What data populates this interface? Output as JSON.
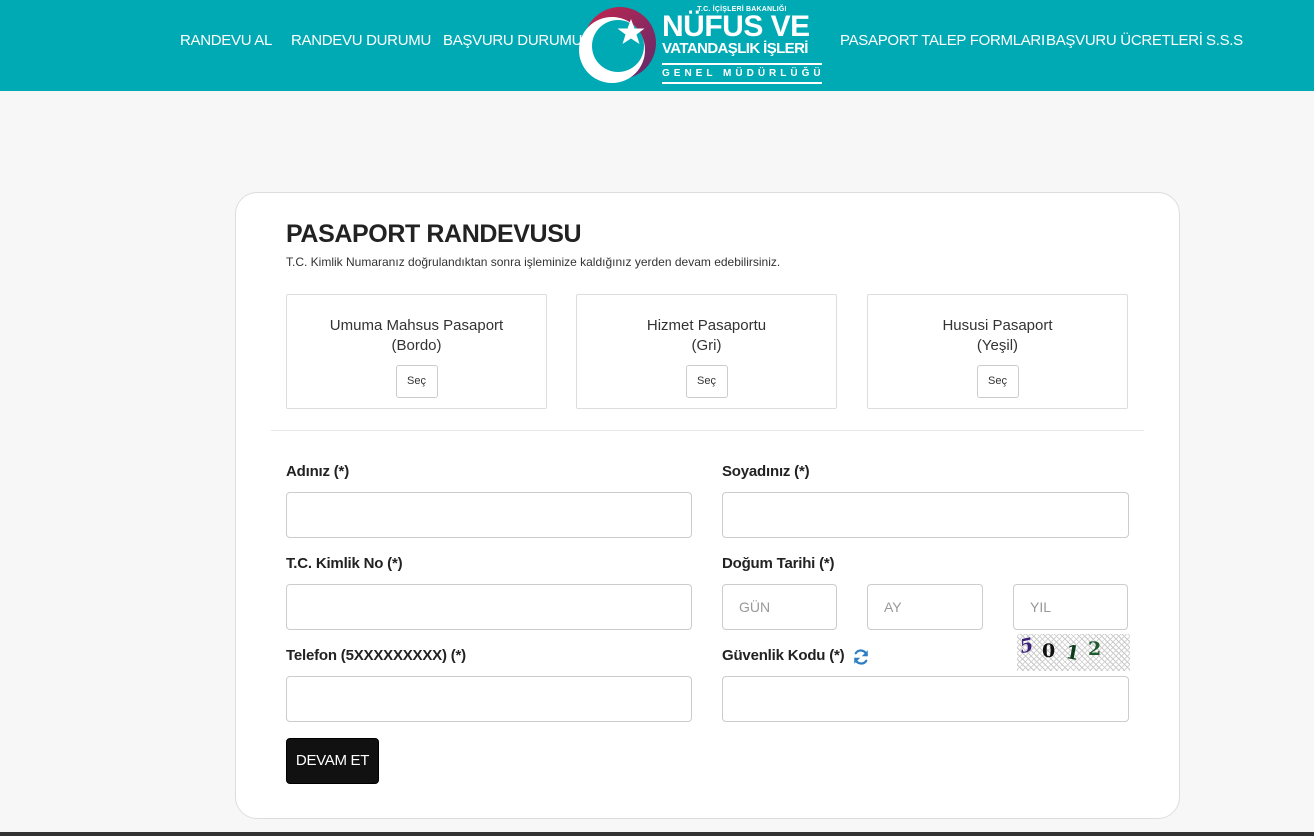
{
  "header": {
    "nav_left": [
      "RANDEVU AL",
      "RANDEVU DURUMU",
      "BAŞVURU DURUMU"
    ],
    "nav_right": [
      "PASAPORT TALEP FORMLARI",
      "BAŞVURU ÜCRETLERİ",
      "S.S.S"
    ],
    "logo": {
      "ministry": "T.C. İÇİŞLERİ BAKANLIĞI",
      "line1": "NÜFUS VE",
      "line2": "VATANDAŞLIK İŞLERİ",
      "line3": "GENEL MÜDÜRLÜĞÜ"
    },
    "bg_color": "#00aab5"
  },
  "form": {
    "title": "PASAPORT RANDEVUSU",
    "subtitle": "T.C. Kimlik Numaranız doğrulandıktan sonra işleminize kaldığınız yerden devam edebilirsiniz.",
    "passport_types": [
      {
        "name": "Umuma Mahsus Pasaport",
        "color": "(Bordo)",
        "button": "Seç"
      },
      {
        "name": "Hizmet Pasaportu",
        "color": "(Gri)",
        "button": "Seç"
      },
      {
        "name": "Hususi Pasaport",
        "color": "(Yeşil)",
        "button": "Seç"
      }
    ],
    "fields": {
      "first_name": {
        "label": "Adınız (*)",
        "value": ""
      },
      "last_name": {
        "label": "Soyadınız (*)",
        "value": ""
      },
      "tc_no": {
        "label": "T.C. Kimlik No (*)",
        "value": ""
      },
      "birth_date": {
        "label": "Doğum Tarihi (*)",
        "day_placeholder": "GÜN",
        "month_placeholder": "AY",
        "year_placeholder": "YIL"
      },
      "phone": {
        "label": "Telefon (5XXXXXXXXX) (*)",
        "value": ""
      },
      "security_code": {
        "label": "Güvenlik Kodu (*)",
        "value": ""
      }
    },
    "captcha": {
      "chars": [
        "5",
        "0",
        "1",
        "2"
      ],
      "icon": "refresh-icon"
    },
    "submit_label": "DEVAM ET"
  }
}
